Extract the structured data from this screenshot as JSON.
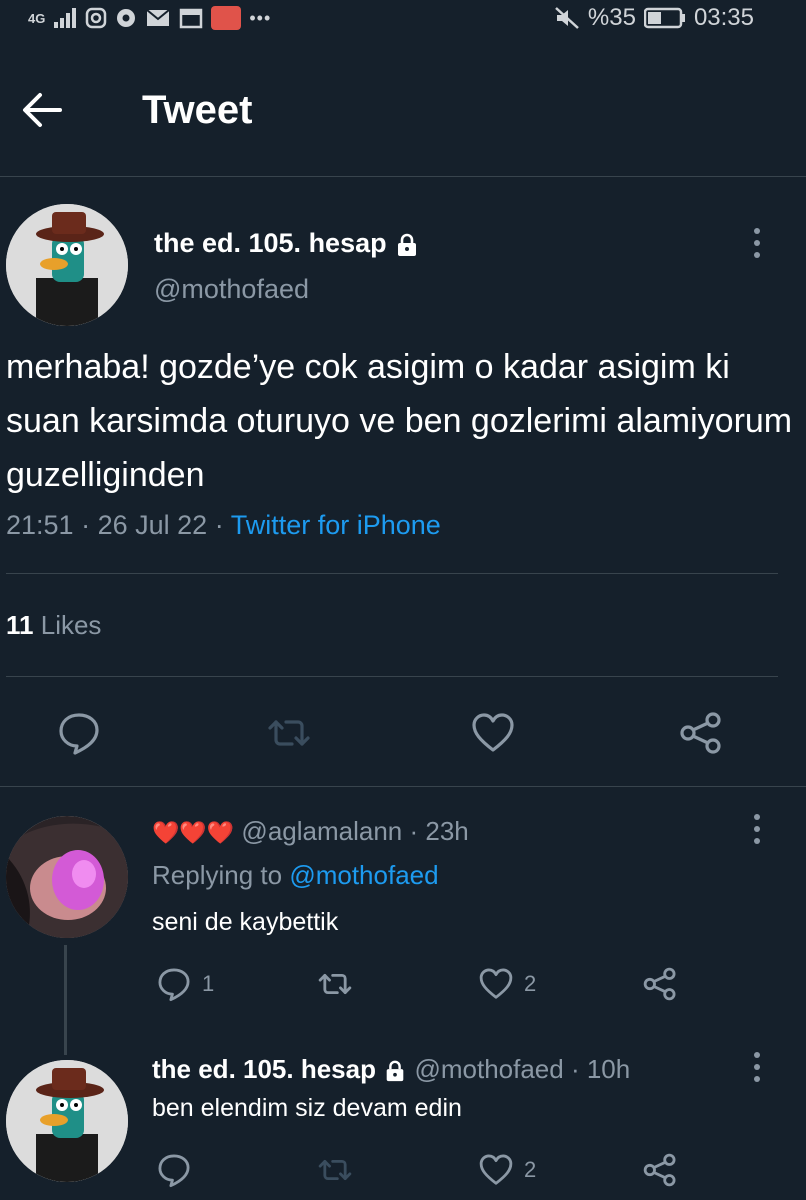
{
  "status_bar": {
    "network": "4G",
    "battery": "%35",
    "time": "03:35",
    "icons": [
      "signal-icon",
      "instagram-icon",
      "soccer-icon",
      "mail-icon",
      "calendar-icon",
      "hms-app-icon",
      "more-dots-icon",
      "mute-icon",
      "battery-icon"
    ]
  },
  "header": {
    "title": "Tweet"
  },
  "tweet": {
    "display_name": "the ed. 105. hesap",
    "handle": "@mothofaed",
    "text": "merhaba! gozde’ye cok asigim o kadar asigim ki suan karsimda oturuyo ve ben gozlerimi alamiyorum guzelliginden",
    "time": "21:51",
    "sep": "·",
    "date": "26 Jul 22",
    "source": "Twitter for iPhone",
    "likes_count": "11",
    "likes_label": "Likes"
  },
  "replies": [
    {
      "display_name": "",
      "emoji": "❤️❤️❤️",
      "handle": "@aglamalann",
      "age": "· 23h",
      "replying_label": "Replying to",
      "replying_to": "@mothofaed",
      "text": "seni de kaybettik",
      "reply_count": "1",
      "like_count": "2"
    },
    {
      "display_name": "the ed. 105. hesap",
      "handle": "@mothofaed",
      "age": "· 10h",
      "text": "ben elendim siz devam edin",
      "like_count": "2"
    }
  ],
  "colors": {
    "background": "#15202b",
    "accent": "#1d9bf0",
    "muted": "#8b98a5",
    "divider": "#38444d"
  }
}
